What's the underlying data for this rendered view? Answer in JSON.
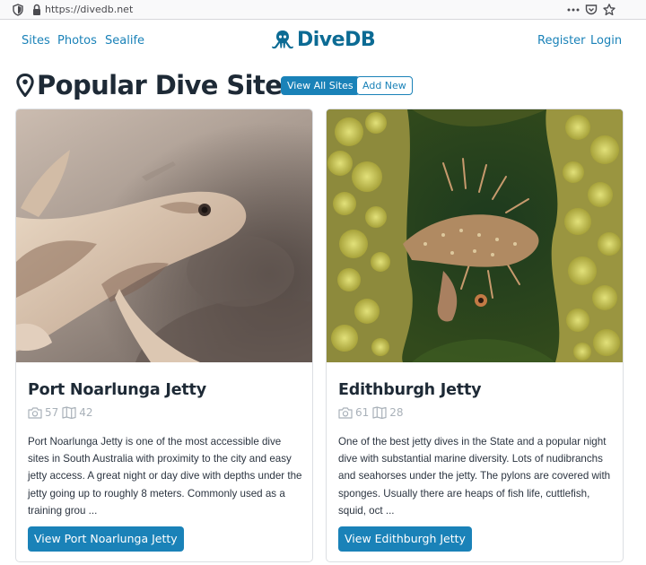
{
  "browser": {
    "url": "https://divedb.net",
    "icons": [
      "shield-icon",
      "lock-icon",
      "more-icon",
      "pocket-icon",
      "star-icon"
    ]
  },
  "nav": {
    "links_left": [
      "Sites",
      "Photos",
      "Sealife"
    ],
    "brand": "DiveDB",
    "links_right": [
      "Register",
      "Login"
    ]
  },
  "heading": {
    "title": "Popular Dive Sites",
    "icon": "map-pin-icon",
    "view_all_label": "View All Sites",
    "add_new_label": "Add New"
  },
  "sites": [
    {
      "name": "Port Noarlunga Jetty",
      "photos": "57",
      "maps": "42",
      "description": "Port Noarlunga Jetty is one of the most accessible dive sites in South Australia with proximity to the city and easy jetty access. A great night or day dive with depths under the jetty going up to roughly 8 meters. Commonly used as a training grou ...",
      "button_label": "View Port Noarlunga Jetty"
    },
    {
      "name": "Edithburgh Jetty",
      "photos": "61",
      "maps": "28",
      "description": "One of the best jetty dives in the State and a popular night dive with substantial marine diversity. Lots of nudibranchs and seahorses under the jetty. The pylons are covered with sponges. Usually there are heaps of fish life, cuttlefish, squid, oct ...",
      "button_label": "View Edithburgh Jetty"
    }
  ],
  "colors": {
    "accent": "#1a82b8",
    "brand": "#0c6b94",
    "heading": "#1e2a36",
    "muted": "#a9b1b9"
  }
}
